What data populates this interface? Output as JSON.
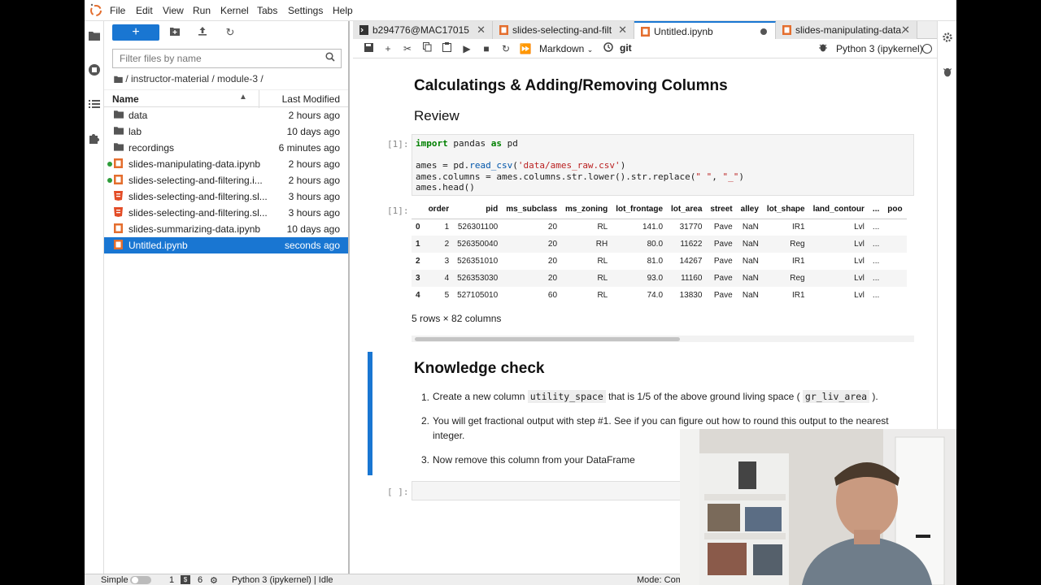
{
  "menu": [
    "File",
    "Edit",
    "View",
    "Run",
    "Kernel",
    "Tabs",
    "Settings",
    "Help"
  ],
  "file_browser": {
    "new_label": "+",
    "filter_placeholder": "Filter files by name",
    "breadcrumb": "/ instructor-material / module-3 /",
    "columns": {
      "name": "Name",
      "modified": "Last Modified"
    },
    "files": [
      {
        "name": "data",
        "modified": "2 hours ago",
        "kind": "folder",
        "running": false,
        "selected": false
      },
      {
        "name": "lab",
        "modified": "10 days ago",
        "kind": "folder",
        "running": false,
        "selected": false
      },
      {
        "name": "recordings",
        "modified": "6 minutes ago",
        "kind": "folder",
        "running": false,
        "selected": false
      },
      {
        "name": "slides-manipulating-data.ipynb",
        "modified": "2 hours ago",
        "kind": "notebook",
        "running": true,
        "selected": false
      },
      {
        "name": "slides-selecting-and-filtering.i...",
        "modified": "2 hours ago",
        "kind": "notebook",
        "running": true,
        "selected": false
      },
      {
        "name": "slides-selecting-and-filtering.sl...",
        "modified": "3 hours ago",
        "kind": "html",
        "running": false,
        "selected": false
      },
      {
        "name": "slides-selecting-and-filtering.sl...",
        "modified": "3 hours ago",
        "kind": "html",
        "running": false,
        "selected": false
      },
      {
        "name": "slides-summarizing-data.ipynb",
        "modified": "10 days ago",
        "kind": "notebook",
        "running": false,
        "selected": false
      },
      {
        "name": "Untitled.ipynb",
        "modified": "seconds ago",
        "kind": "notebook",
        "running": false,
        "selected": true
      }
    ]
  },
  "tabs": [
    {
      "label": "b294776@MAC17015",
      "kind": "terminal",
      "active": false,
      "dirty": false
    },
    {
      "label": "slides-selecting-and-filterin",
      "kind": "notebook",
      "active": false,
      "dirty": false
    },
    {
      "label": "Untitled.ipynb",
      "kind": "notebook",
      "active": true,
      "dirty": true
    },
    {
      "label": "slides-manipulating-data.ip",
      "kind": "notebook",
      "active": false,
      "dirty": false
    }
  ],
  "toolbar": {
    "cell_type": "Markdown",
    "git": "git",
    "kernel": "Python 3 (ipykernel)"
  },
  "notebook": {
    "title": "Calculatings & Adding/Removing Columns",
    "review": "Review",
    "code_prompt": "[1]:",
    "out_prompt": "[1]:",
    "code": {
      "line1_kw1": "import",
      "line1_mod": " pandas ",
      "line1_kw2": "as",
      "line1_alias": " pd",
      "line2_a": "ames = pd.",
      "line2_fn": "read_csv",
      "line2_b": "(",
      "line2_str": "'data/ames_raw.csv'",
      "line2_c": ")",
      "line3_a": "ames.columns = ames.columns.str.lower().str.replace(",
      "line3_s1": "\" \"",
      "line3_b": ", ",
      "line3_s2": "\"_\"",
      "line3_c": ")",
      "line4": "ames.head()"
    },
    "df_columns": [
      "",
      "order",
      "pid",
      "ms_subclass",
      "ms_zoning",
      "lot_frontage",
      "lot_area",
      "street",
      "alley",
      "lot_shape",
      "land_contour",
      "...",
      "poo"
    ],
    "df_rows": [
      [
        "0",
        "1",
        "526301100",
        "20",
        "RL",
        "141.0",
        "31770",
        "Pave",
        "NaN",
        "IR1",
        "Lvl",
        "..."
      ],
      [
        "1",
        "2",
        "526350040",
        "20",
        "RH",
        "80.0",
        "11622",
        "Pave",
        "NaN",
        "Reg",
        "Lvl",
        "..."
      ],
      [
        "2",
        "3",
        "526351010",
        "20",
        "RL",
        "81.0",
        "14267",
        "Pave",
        "NaN",
        "IR1",
        "Lvl",
        "..."
      ],
      [
        "3",
        "4",
        "526353030",
        "20",
        "RL",
        "93.0",
        "11160",
        "Pave",
        "NaN",
        "Reg",
        "Lvl",
        "..."
      ],
      [
        "4",
        "5",
        "527105010",
        "60",
        "RL",
        "74.0",
        "13830",
        "Pave",
        "NaN",
        "IR1",
        "Lvl",
        "..."
      ]
    ],
    "rows_cols": "5 rows × 82 columns",
    "knowledge_title": "Knowledge check",
    "items": [
      {
        "num": "1.",
        "a": "Create a new column ",
        "code1": "utility_space",
        "b": " that is 1/5 of the above ground living space ( ",
        "code2": "gr_liv_area",
        "c": " )."
      },
      {
        "num": "2.",
        "line1": "You will get fractional output with step #1. See if you can figure out how to round this output to the nearest",
        "line2": "integer."
      },
      {
        "num": "3.",
        "text": "Now remove this column from your DataFrame"
      }
    ],
    "empty_prompt": "[ ]:"
  },
  "status": {
    "mode_label": "Simple",
    "count1": "1",
    "count2": "6",
    "kernel_status": "Python 3 (ipykernel) | Idle",
    "mode": "Mode: Com"
  },
  "colors": {
    "accent": "#1976d2",
    "running_dot": "#2e9d3a",
    "notebook_icon": "#e46e2e"
  }
}
